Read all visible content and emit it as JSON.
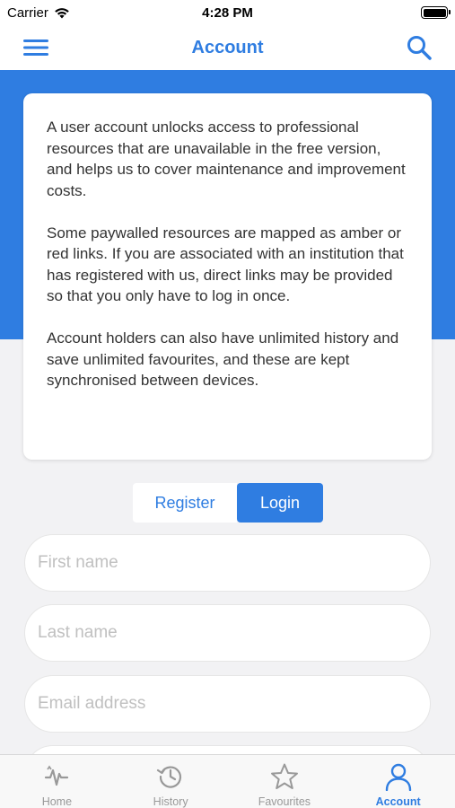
{
  "status_bar": {
    "carrier": "Carrier",
    "time": "4:28 PM"
  },
  "nav": {
    "title": "Account",
    "menu_icon": "hamburger-menu-icon",
    "search_icon": "search-icon"
  },
  "info_card": {
    "paragraphs": [
      "A user account unlocks access to professional resources that are unavailable in the free version, and helps us to cover maintenance and improvement costs.",
      "Some paywalled resources are mapped as amber or red links. If you are associated with an institution that has registered with us, direct links may be provided so that you only have to log in once.",
      "Account holders can also have unlimited history and save unlimited favourites, and these are kept synchronised between devices."
    ]
  },
  "auth_toggle": {
    "register_label": "Register",
    "login_label": "Login",
    "selected": "Login"
  },
  "form": {
    "first_name_placeholder": "First name",
    "last_name_placeholder": "Last name",
    "email_placeholder": "Email address",
    "fourth_placeholder": ""
  },
  "tabs": [
    {
      "label": "Home",
      "icon": "heartbeat-icon"
    },
    {
      "label": "History",
      "icon": "history-icon"
    },
    {
      "label": "Favourites",
      "icon": "star-icon"
    },
    {
      "label": "Account",
      "icon": "user-icon",
      "active": true
    }
  ],
  "colors": {
    "accent": "#2f7de1",
    "background": "#f2f2f4",
    "inactive": "#999999"
  }
}
